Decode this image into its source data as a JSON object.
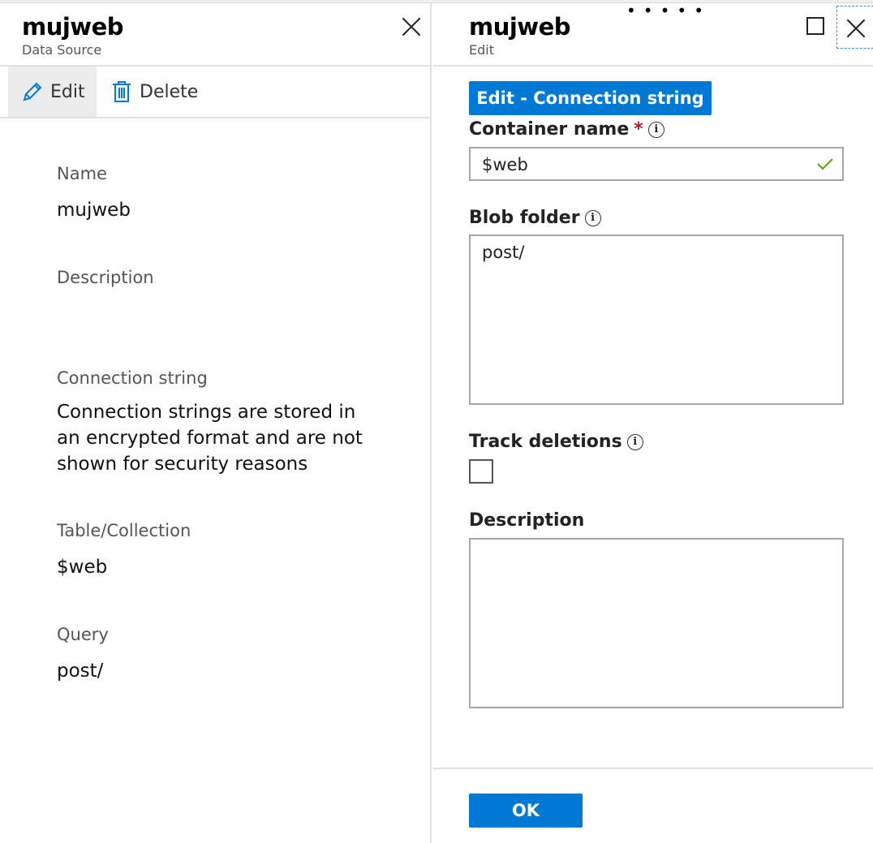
{
  "left": {
    "title": "mujweb",
    "subtitle": "Data Source",
    "toolbar": {
      "edit_label": "Edit",
      "delete_label": "Delete"
    },
    "properties": [
      {
        "label": "Name",
        "value": "mujweb"
      },
      {
        "label": "Description",
        "value": ""
      },
      {
        "label": "Connection string",
        "value_lines": [
          "Connection strings are stored in",
          "an encrypted format and are not",
          "shown for security reasons"
        ]
      },
      {
        "label": "Table/Collection",
        "value": "$web"
      },
      {
        "label": "Query",
        "value": "post/"
      }
    ]
  },
  "right": {
    "title": "mujweb",
    "subtitle": "Edit",
    "edit_connection_button": "Edit - Connection string",
    "container_name": {
      "label": "Container name",
      "required": "*",
      "value": "$web"
    },
    "blob_folder": {
      "label": "Blob folder",
      "value": "post/"
    },
    "track_deletions": {
      "label": "Track deletions",
      "checked": false
    },
    "description": {
      "label": "Description",
      "value": ""
    },
    "ok_button": "OK",
    "info_glyph": "i",
    "dots": "•••••"
  },
  "colors": {
    "primary": "#0078d4",
    "required": "#a4262c",
    "valid": "#57a300"
  }
}
